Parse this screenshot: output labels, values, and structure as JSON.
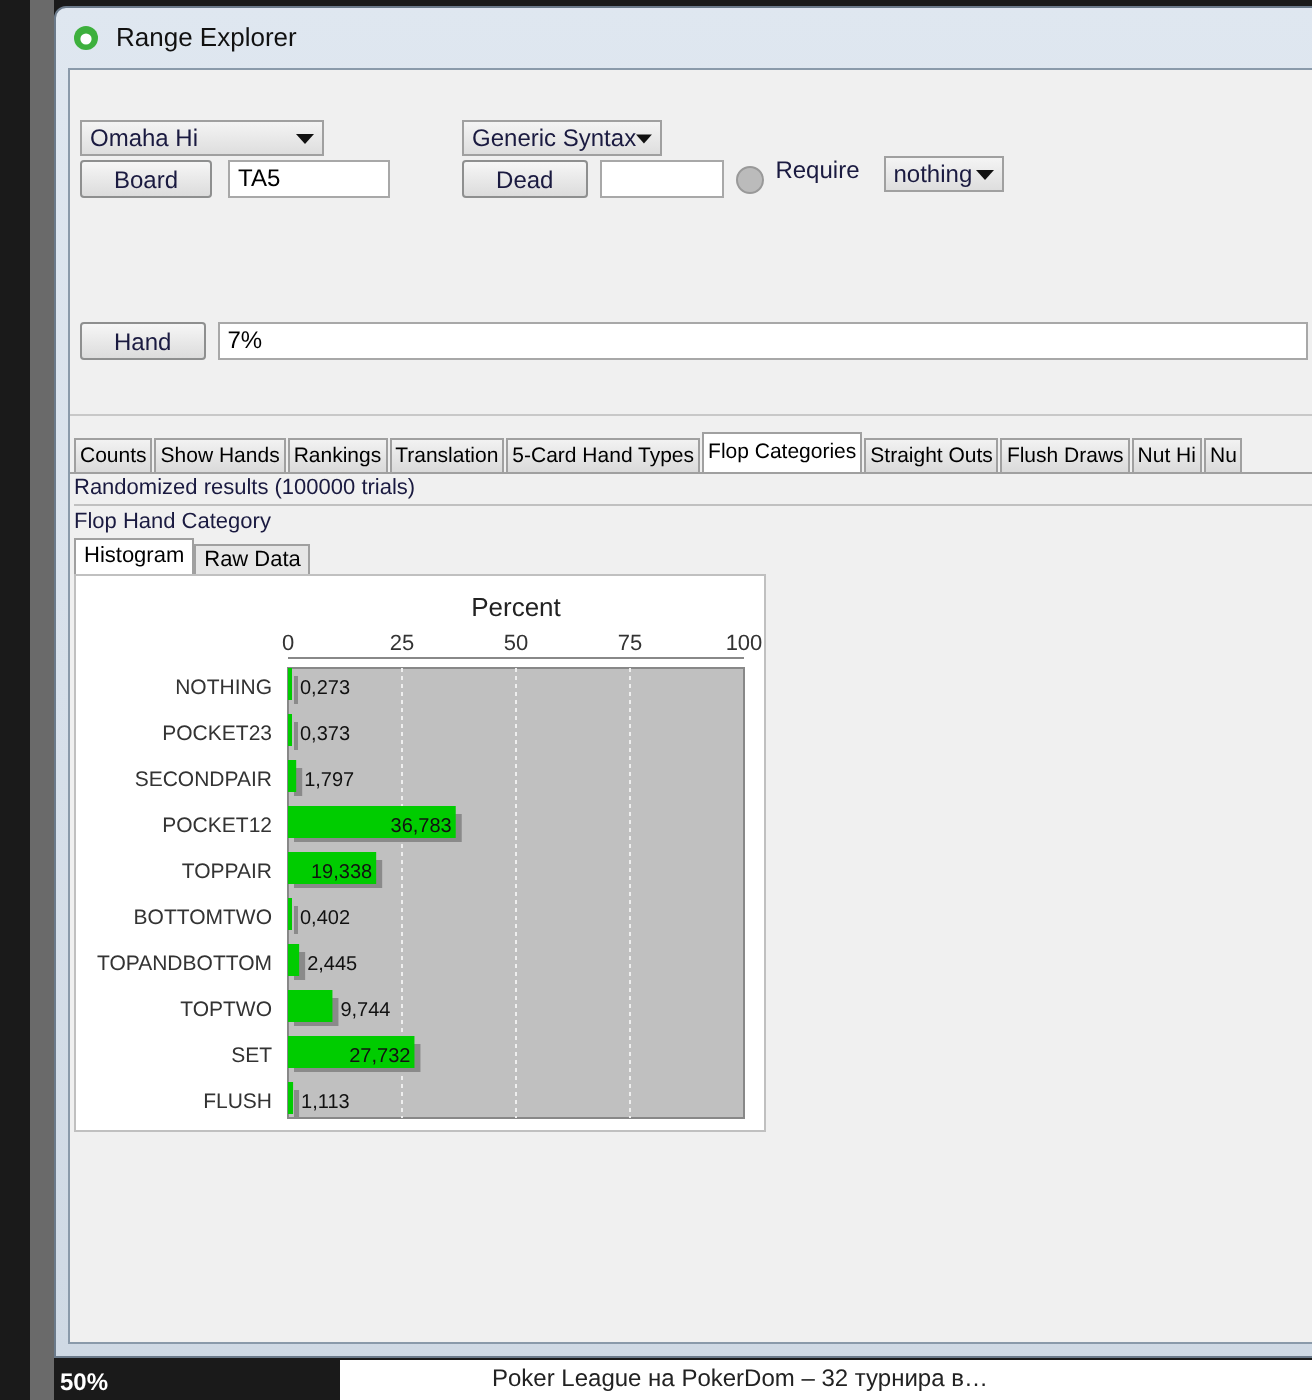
{
  "window": {
    "title": "Range Explorer"
  },
  "game_select": {
    "value": "Omaha Hi"
  },
  "syntax_select": {
    "value": "Generic Syntax"
  },
  "board": {
    "button": "Board",
    "value": "TA5"
  },
  "dead": {
    "button": "Dead"
  },
  "require": {
    "selected": false,
    "label": "Require",
    "value": "nothing"
  },
  "hand": {
    "button": "Hand",
    "value": "7%"
  },
  "tabs": [
    {
      "label": "Counts",
      "selected": false
    },
    {
      "label": "Show Hands",
      "selected": false
    },
    {
      "label": "Rankings",
      "selected": false
    },
    {
      "label": "Translation",
      "selected": false
    },
    {
      "label": "5-Card Hand Types",
      "selected": false
    },
    {
      "label": "Flop Categories",
      "selected": true
    },
    {
      "label": "Straight Outs",
      "selected": false
    },
    {
      "label": "Flush Draws",
      "selected": false
    },
    {
      "label": "Nut Hi",
      "selected": false
    },
    {
      "label": "Nu",
      "selected": false
    }
  ],
  "results_note": "Randomized results (100000 trials)",
  "section_title": "Flop Hand Category",
  "subtabs": [
    {
      "label": "Histogram",
      "selected": true
    },
    {
      "label": "Raw Data",
      "selected": false
    }
  ],
  "chart_data": {
    "type": "bar",
    "orientation": "horizontal",
    "title": "Percent",
    "categories": [
      "NOTHING",
      "POCKET23",
      "SECONDPAIR",
      "POCKET12",
      "TOPPAIR",
      "BOTTOMTWO",
      "TOPANDBOTTOM",
      "TOPTWO",
      "SET",
      "FLUSH"
    ],
    "values": [
      0.273,
      0.373,
      1.797,
      36.783,
      19.338,
      0.402,
      2.445,
      9.744,
      27.732,
      1.113
    ],
    "grid": true,
    "value_labels": [
      "0,273",
      "0,373",
      "1,797",
      "36,783",
      "19,338",
      "0,402",
      "2,445",
      "9,744",
      "27,732",
      "1,113"
    ],
    "xlim": [
      0,
      100
    ],
    "xticks": [
      0,
      25,
      50,
      75,
      100
    ]
  },
  "taskbar": {
    "zoom": "50%"
  },
  "news": {
    "headline": "Poker League на PokerDom – 32 турнира в…"
  }
}
